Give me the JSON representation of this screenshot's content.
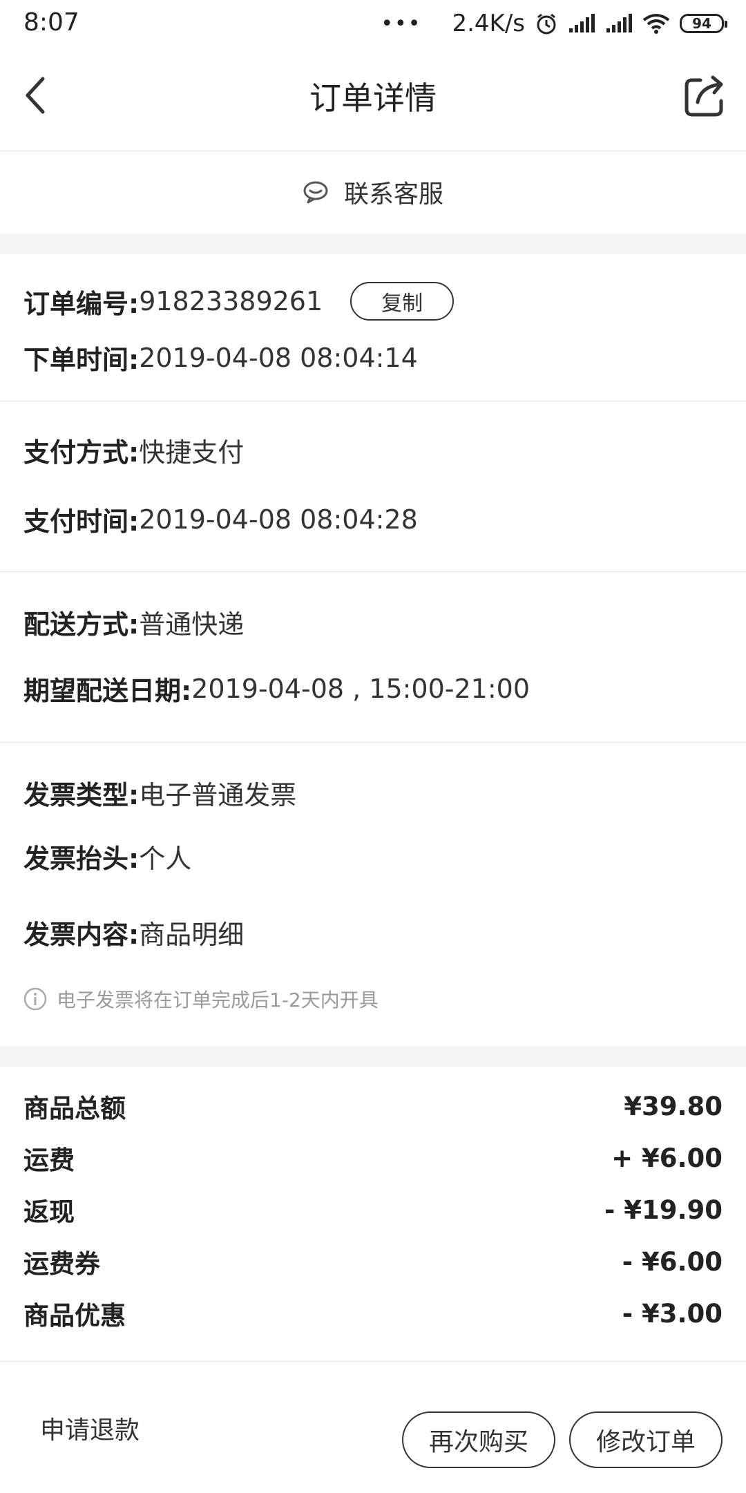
{
  "status_bar": {
    "time": "8:07",
    "dots": "•••",
    "net_speed": "2.4K/s",
    "battery": "94",
    "icons": [
      "alarm-icon",
      "signal-icon",
      "signal-icon",
      "wifi-icon",
      "battery-icon"
    ]
  },
  "header": {
    "title": "订单详情",
    "back_icon": "chevron-left-icon",
    "share_icon": "share-icon"
  },
  "contact": {
    "label": "联系客服",
    "icon": "chat-icon"
  },
  "order": {
    "number_label": "订单编号:",
    "number_value": "91823389261",
    "copy_label": "复制",
    "time_label": "下单时间:",
    "time_value": "2019-04-08 08:04:14"
  },
  "payment": {
    "method_label": "支付方式:",
    "method_value": "快捷支付",
    "time_label": "支付时间:",
    "time_value": "2019-04-08 08:04:28"
  },
  "delivery": {
    "method_label": "配送方式:",
    "method_value": "普通快递",
    "date_label": "期望配送日期:",
    "date_value": "2019-04-08 , 15:00-21:00"
  },
  "invoice": {
    "type_label": "发票类型:",
    "type_value": "电子普通发票",
    "title_label": "发票抬头:",
    "title_value": "个人",
    "content_label": "发票内容:",
    "content_value": "商品明细",
    "note": "电子发票将在订单完成后1-2天内开具"
  },
  "amounts": [
    {
      "label": "商品总额",
      "value": "¥39.80"
    },
    {
      "label": "运费",
      "value": "+ ¥6.00"
    },
    {
      "label": "返现",
      "value": "- ¥19.90"
    },
    {
      "label": "运费券",
      "value": "- ¥6.00"
    },
    {
      "label": "商品优惠",
      "value": "- ¥3.00"
    }
  ],
  "bottom_bar": {
    "refund_label": "申请退款",
    "rebuy_label": "再次购买",
    "modify_label": "修改订单"
  }
}
